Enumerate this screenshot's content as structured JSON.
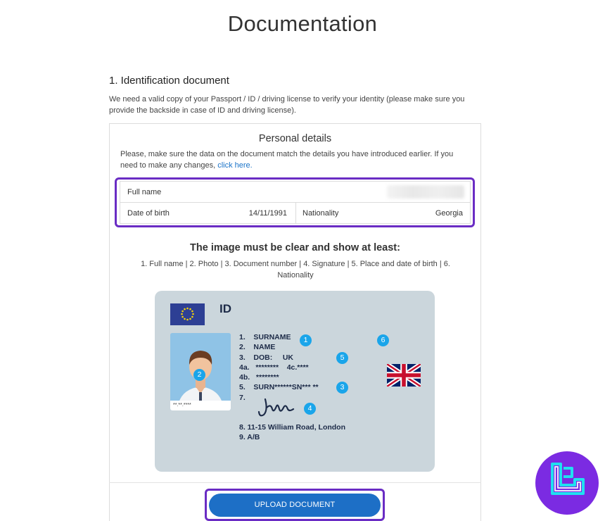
{
  "page": {
    "title": "Documentation"
  },
  "section": {
    "title": "1. Identification document",
    "description": "We need a valid copy of your Passport / ID / driving license to verify your identity (please make sure you provide the backside in case of ID and driving license)."
  },
  "personal_details": {
    "title": "Personal details",
    "description": "Please, make sure the data on the document match the details you have introduced earlier. If you need to make any changes,",
    "link_text": "click here.",
    "rows": {
      "full_name_label": "Full name",
      "dob_label": "Date of birth",
      "dob_value": "14/11/1991",
      "nationality_label": "Nationality",
      "nationality_value": "Georgia"
    }
  },
  "requirements": {
    "title": "The image must be clear and show at least:",
    "text": "1. Full name | 2. Photo | 3. Document number | 4. Signature | 5. Place and date of birth | 6. Nationality"
  },
  "id_card": {
    "label": "ID",
    "photo_strip_text": "**.**.****",
    "fields": [
      "1.    SURNAME",
      "2.    NAME",
      "3.    DOB:     UK",
      "4a.   ********    4c.****",
      "4b.   ********",
      "5.    SURN******SN*** **",
      "7."
    ],
    "fields_bottom": [
      "8.    11-15 William Road, London",
      "9.    A/B"
    ],
    "markers": [
      "1",
      "2",
      "3",
      "4",
      "5",
      "6"
    ]
  },
  "upload": {
    "button_label": "UPLOAD DOCUMENT"
  },
  "colors": {
    "highlight": "#6a2cc4",
    "button": "#1d6fc6",
    "marker": "#1aa5ea",
    "card": "#cbd6dc",
    "logo": "#7b2be2"
  },
  "icons": {
    "eu_flag": "eu-flag-icon",
    "uk_flag": "uk-flag-icon",
    "signature": "signature-icon",
    "brand_logo": "brand-logo-icon"
  }
}
